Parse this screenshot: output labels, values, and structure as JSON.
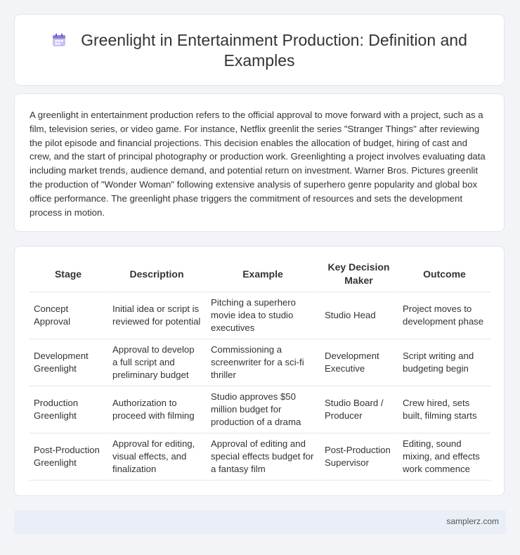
{
  "header": {
    "title_line1": "Greenlight in Entertainment Production: Definition and",
    "title_line2": "Examples",
    "icon": "calendar-icon"
  },
  "description": "A greenlight in entertainment production refers to the official approval to move forward with a project, such as a film, television series, or video game. For instance, Netflix greenlit the series \"Stranger Things\" after reviewing the pilot episode and financial projections. This decision enables the allocation of budget, hiring of cast and crew, and the start of principal photography or production work. Greenlighting a project involves evaluating data including market trends, audience demand, and potential return on investment. Warner Bros. Pictures greenlit the production of \"Wonder Woman\" following extensive analysis of superhero genre popularity and global box office performance. The greenlight phase triggers the commitment of resources and sets the development process in motion.",
  "table": {
    "headers": [
      "Stage",
      "Description",
      "Example",
      "Key Decision Maker",
      "Outcome"
    ],
    "rows": [
      [
        "Concept Approval",
        "Initial idea or script is reviewed for potential",
        "Pitching a superhero movie idea to studio executives",
        "Studio Head",
        "Project moves to development phase"
      ],
      [
        "Development Greenlight",
        "Approval to develop a full script and preliminary budget",
        "Commissioning a screenwriter for a sci-fi thriller",
        "Development Executive",
        "Script writing and budgeting begin"
      ],
      [
        "Production Greenlight",
        "Authorization to proceed with filming",
        "Studio approves $50 million budget for production of a drama",
        "Studio Board / Producer",
        "Crew hired, sets built, filming starts"
      ],
      [
        "Post-Production Greenlight",
        "Approval for editing, visual effects, and finalization",
        "Approval of editing and special effects budget for a fantasy film",
        "Post-Production Supervisor",
        "Editing, sound mixing, and effects work commence"
      ]
    ]
  },
  "footer": {
    "link_text": "samplerz.com"
  },
  "colors": {
    "background": "#f2f4f7",
    "card": "#ffffff",
    "footer_bg": "#e9eef7",
    "icon_accent": "#8a7fd6"
  }
}
